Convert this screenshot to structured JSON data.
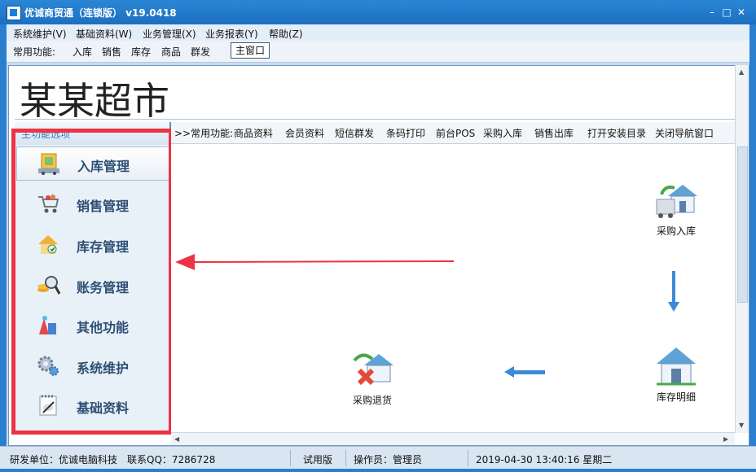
{
  "window": {
    "title": "优诚商贸通（连锁版）  v19.0418",
    "controls": {
      "minimize": "–",
      "maximize": "□",
      "close": "✕"
    }
  },
  "menu": [
    "系统维护(V)",
    "基础资料(W)",
    "业务管理(X)",
    "业务报表(Y)",
    "帮助(Z)"
  ],
  "toolbar": {
    "label": "常用功能:",
    "items": [
      "入库",
      "销售",
      "库存",
      "商品",
      "群发"
    ],
    "main_window": "主窗口"
  },
  "banner": {
    "store_name": "某某超市"
  },
  "sidebar": {
    "heading": "主功能选项",
    "items": [
      {
        "label": "入库管理",
        "icon": "warehouse-in-icon",
        "active": true
      },
      {
        "label": "销售管理",
        "icon": "shopping-cart-icon",
        "active": false
      },
      {
        "label": "库存管理",
        "icon": "inventory-house-icon",
        "active": false
      },
      {
        "label": "账务管理",
        "icon": "coins-magnifier-icon",
        "active": false
      },
      {
        "label": "其他功能",
        "icon": "other-functions-icon",
        "active": false
      },
      {
        "label": "系统维护",
        "icon": "gears-icon",
        "active": false
      },
      {
        "label": "基础资料",
        "icon": "notepad-icon",
        "active": false
      }
    ]
  },
  "quickbar": {
    "label": ">>常用功能:",
    "items": [
      "商品资料",
      "会员资料",
      "短信群发",
      "条码打印",
      "前台POS",
      "采购入库",
      "销售出库",
      "打开安装目录",
      "关闭导航窗口"
    ]
  },
  "flow": {
    "purchase_in": "采购入库",
    "inventory_detail": "库存明细",
    "purchase_return": "采购退货"
  },
  "status": {
    "developer": "研发单位：优诚电脑科技",
    "qq": "联系QQ：7286728",
    "edition": "试用版",
    "operator": "操作员：管理员",
    "datetime": "2019-04-30 13:40:16 星期二"
  },
  "colors": {
    "titlebar": "#1c6fc0",
    "highlight_box": "#ee3344",
    "flow_arrow": "#2b7fd0"
  }
}
